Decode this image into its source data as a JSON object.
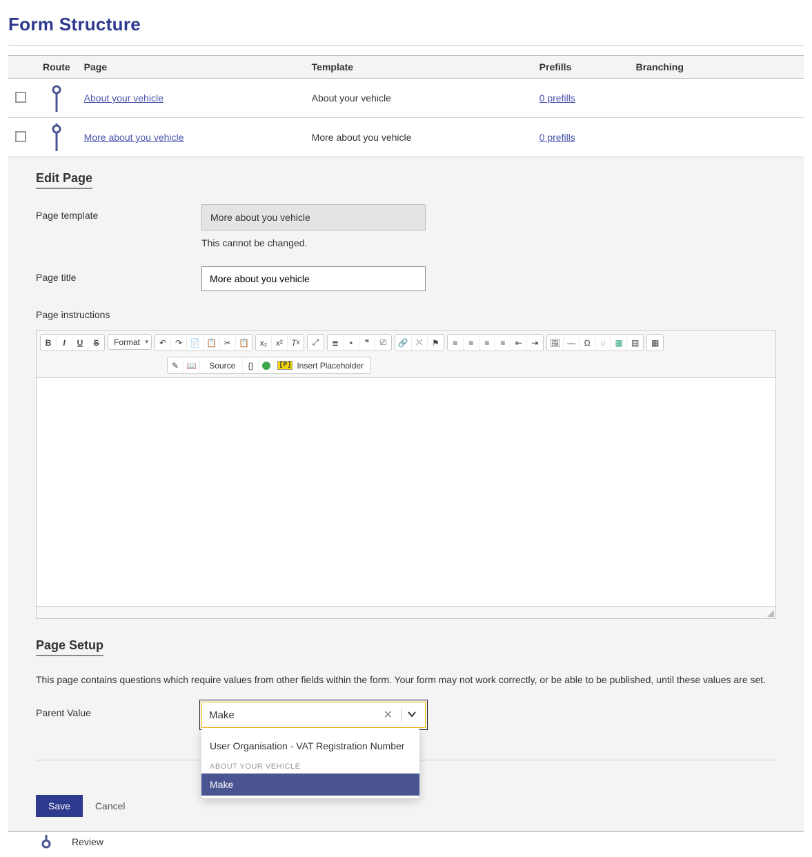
{
  "title": "Form Structure",
  "columns": {
    "route": "Route",
    "page": "Page",
    "template": "Template",
    "prefills": "Prefills",
    "branching": "Branching"
  },
  "rows": [
    {
      "page": "About your vehicle",
      "template": "About your vehicle",
      "prefills": "0 prefills"
    },
    {
      "page": "More about you vehicle",
      "template": "More about you vehicle",
      "prefills": "0 prefills"
    }
  ],
  "edit": {
    "heading": "Edit Page",
    "page_template_label": "Page template",
    "page_template_value": "More about you vehicle",
    "page_template_hint": "This cannot be changed.",
    "page_title_label": "Page title",
    "page_title_value": "More about you vehicle",
    "page_instructions_label": "Page instructions",
    "format_label": "Format",
    "source_label": "Source",
    "insert_ph_label": "Insert Placeholder",
    "setup_heading": "Page Setup",
    "setup_text": "This page contains questions which require values from other fields within the form. Your form may not work correctly, or be able to be published, until these values are set.",
    "parent_value_label": "Parent Value",
    "parent_value_selected": "Make",
    "dropdown": {
      "item1": "User Organisation - VAT Registration Number",
      "group": "ABOUT YOUR VEHICLE",
      "active": "Make"
    },
    "save": "Save",
    "cancel": "Cancel"
  },
  "trail": "Review"
}
